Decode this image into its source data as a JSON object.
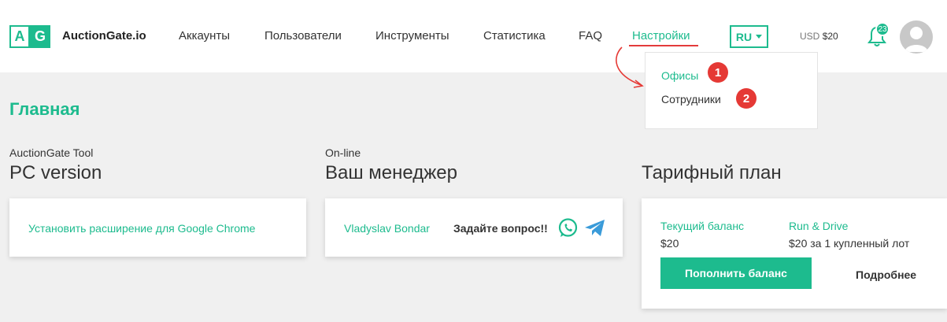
{
  "brand": {
    "logo_left": "A",
    "logo_right": "G",
    "name": "AuctionGate.io"
  },
  "nav": {
    "items": [
      {
        "label": "Аккаунты"
      },
      {
        "label": "Пользователи"
      },
      {
        "label": "Инструменты"
      },
      {
        "label": "Статистика"
      },
      {
        "label": "FAQ"
      },
      {
        "label": "Настройки"
      }
    ]
  },
  "language": {
    "selected": "RU"
  },
  "balance": {
    "currency": "USD",
    "amount": "$20"
  },
  "notifications": {
    "count": "23"
  },
  "dropdown": {
    "items": [
      {
        "label": "Офисы",
        "marker": "1"
      },
      {
        "label": "Сотрудники",
        "marker": "2"
      }
    ]
  },
  "page": {
    "title": "Главная"
  },
  "sections": {
    "tool": {
      "label": "AuctionGate Tool",
      "title": "PC version",
      "link": "Установить расширение для Google Chrome"
    },
    "manager": {
      "label": "On-line",
      "title": "Ваш менеджер",
      "name": "Vladyslav Bondar",
      "question": "Задайте вопрос!!"
    },
    "tariff": {
      "title": "Тарифный план",
      "balance_label": "Текущий баланс",
      "balance_value": "$20",
      "plan_label": "Run & Drive",
      "plan_value": "$20 за 1 купленный лот",
      "topup_button": "Пополнить баланс",
      "more_link": "Подробнее"
    }
  },
  "colors": {
    "accent": "#1dbb8e",
    "marker": "#e53935"
  }
}
